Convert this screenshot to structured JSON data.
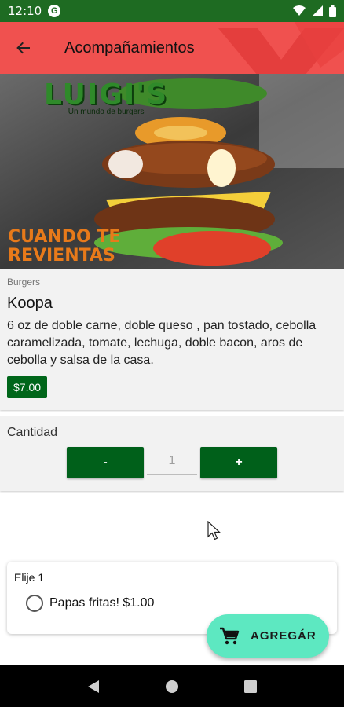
{
  "status_bar": {
    "time": "12:10",
    "badge": "G"
  },
  "app_bar": {
    "title": "Acompañamientos"
  },
  "hero": {
    "logo_text": "LUIGI'S",
    "logo_tagline": "Un mundo de burgers",
    "slogan_line1": "CUANDO TE",
    "slogan_line2": "REVIENTAS"
  },
  "product": {
    "category": "Burgers",
    "name": "Koopa",
    "description": "6 oz de doble carne,  doble queso , pan tostado, cebolla caramelizada, tomate, lechuga, doble bacon, aros de cebolla y salsa de la casa.",
    "price": "$7.00"
  },
  "quantity": {
    "label": "Cantidad",
    "minus_label": "-",
    "value": "1",
    "plus_label": "+"
  },
  "options": {
    "title": "Elije 1",
    "items": [
      {
        "label": "Papas fritas! $1.00",
        "selected": false
      }
    ]
  },
  "fab": {
    "label": "AGREGÁR",
    "color": "#5de8c1"
  },
  "colors": {
    "status_bar": "#1e6b22",
    "app_bar": "#f0514f",
    "button_green": "#00601a"
  }
}
